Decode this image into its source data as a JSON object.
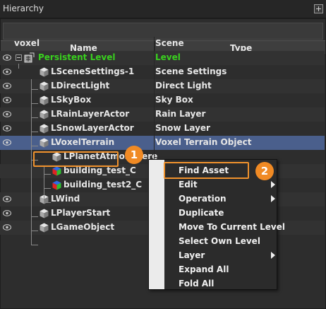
{
  "window": {
    "title": "Hierarchy"
  },
  "columns": {
    "name": "Name",
    "type": "Type"
  },
  "rows": [
    {
      "name": "voxel",
      "type": "Scene"
    },
    {
      "name": "Persistent Level",
      "type": "Level"
    },
    {
      "name": "LSceneSettings-1",
      "type": "Scene Settings"
    },
    {
      "name": "LDirectLight",
      "type": "Direct Light"
    },
    {
      "name": "LSkyBox",
      "type": "Sky Box"
    },
    {
      "name": "LRainLayerActor",
      "type": "Rain Layer"
    },
    {
      "name": "LSnowLayerActor",
      "type": "Snow Layer"
    },
    {
      "name": "LVoxelTerrain",
      "type": "Voxel Terrain Object"
    },
    {
      "name": "LPlanetAtmosphere",
      "type": ""
    },
    {
      "name": "building_test_C",
      "type": ""
    },
    {
      "name": "building_test2_C",
      "type": ""
    },
    {
      "name": "LWind",
      "type": ""
    },
    {
      "name": "LPlayerStart",
      "type": ""
    },
    {
      "name": "LGameObject",
      "type": ""
    }
  ],
  "context_menu": {
    "items": [
      {
        "label": "Find Asset"
      },
      {
        "label": "Edit"
      },
      {
        "label": "Operation"
      },
      {
        "label": "Duplicate"
      },
      {
        "label": "Move To Current Level"
      },
      {
        "label": "Select Own Level"
      },
      {
        "label": "Layer"
      },
      {
        "label": "Expand All"
      },
      {
        "label": "Fold All"
      }
    ]
  },
  "callouts": {
    "step1": "1",
    "step2": "2"
  },
  "colors": {
    "level_green": "#39d01e",
    "callout_orange": "#f08a24",
    "selection": "#4a5f8c"
  }
}
